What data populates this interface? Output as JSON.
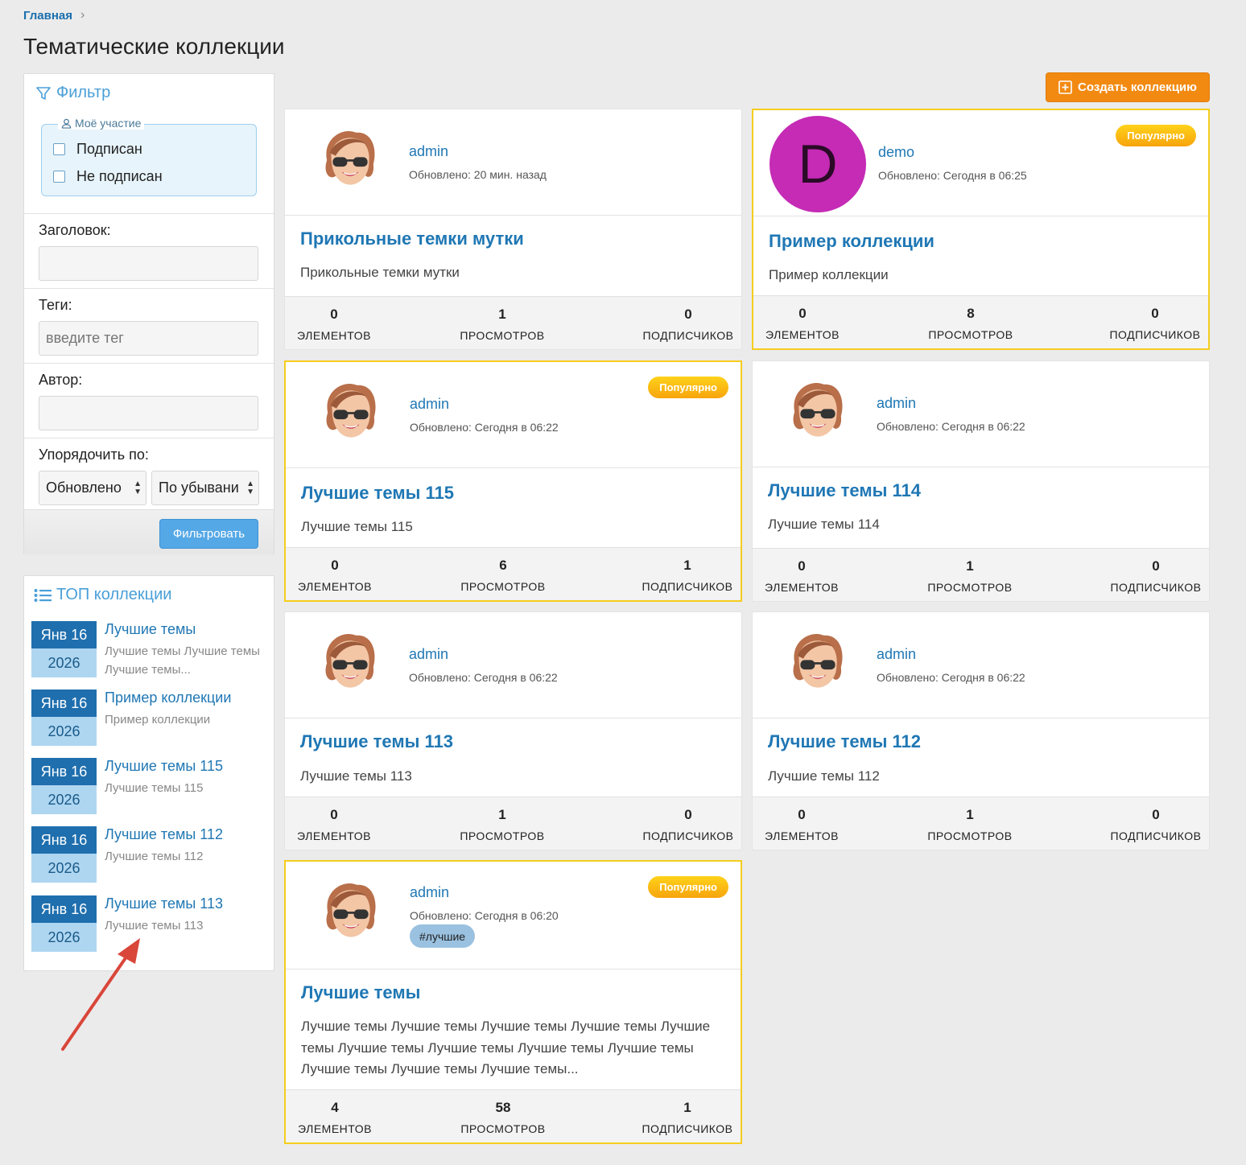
{
  "breadcrumb": {
    "home": "Главная",
    "separator": "›"
  },
  "page_title": "Тематические коллекции",
  "filter": {
    "title": "Фильтр",
    "participation_legend": "Моё участие",
    "subscribed_label": "Подписан",
    "not_subscribed_label": "Не подписан",
    "heading_label": "Заголовок:",
    "tags_label": "Теги:",
    "tags_placeholder": "введите тег",
    "author_label": "Автор:",
    "order_label": "Упорядочить по:",
    "order_field": "Обновлено",
    "order_direction": "По убывани",
    "submit_label": "Фильтровать"
  },
  "top_collections": {
    "title": "ТОП коллекции",
    "items": [
      {
        "date_top": "Янв 16",
        "date_bottom": "2026",
        "title": "Лучшие темы",
        "desc": "Лучшие темы Лучшие темы Лучшие темы..."
      },
      {
        "date_top": "Янв 16",
        "date_bottom": "2026",
        "title": "Пример коллекции",
        "desc": "Пример коллекции"
      },
      {
        "date_top": "Янв 16",
        "date_bottom": "2026",
        "title": "Лучшие темы 115",
        "desc": "Лучшие темы 115"
      },
      {
        "date_top": "Янв 16",
        "date_bottom": "2026",
        "title": "Лучшие темы 112",
        "desc": "Лучшие темы 112"
      },
      {
        "date_top": "Янв 16",
        "date_bottom": "2026",
        "title": "Лучшие темы 113",
        "desc": "Лучшие темы 113"
      }
    ]
  },
  "create_button": "Создать коллекцию",
  "popular_badge": "Популярно",
  "stat_labels": {
    "elements": "ЭЛЕМЕНТОВ",
    "views": "ПРОСМОТРОВ",
    "subscribers": "ПОДПИСЧИКОВ"
  },
  "cards": [
    {
      "author": "admin",
      "updated": "Обновлено: 20 мин. назад",
      "title": "Прикольные темки мутки",
      "desc": "Прикольные темки мутки",
      "elements": "0",
      "views": "1",
      "subscribers": "0"
    },
    {
      "author": "demo",
      "avatar_letter": "D",
      "updated": "Обновлено: Сегодня в 06:25",
      "title": "Пример коллекции",
      "desc": "Пример коллекции",
      "elements": "0",
      "views": "8",
      "subscribers": "0"
    },
    {
      "author": "admin",
      "updated": "Обновлено: Сегодня в 06:22",
      "title": "Лучшие темы 115",
      "desc": "Лучшие темы 115",
      "elements": "0",
      "views": "6",
      "subscribers": "1"
    },
    {
      "author": "admin",
      "updated": "Обновлено: Сегодня в 06:22",
      "title": "Лучшие темы 114",
      "desc": "Лучшие темы 114",
      "elements": "0",
      "views": "1",
      "subscribers": "0"
    },
    {
      "author": "admin",
      "updated": "Обновлено: Сегодня в 06:22",
      "title": "Лучшие темы 113",
      "desc": "Лучшие темы 113",
      "elements": "0",
      "views": "1",
      "subscribers": "0"
    },
    {
      "author": "admin",
      "updated": "Обновлено: Сегодня в 06:22",
      "title": "Лучшие темы 112",
      "desc": "Лучшие темы 112",
      "elements": "0",
      "views": "1",
      "subscribers": "0"
    },
    {
      "author": "admin",
      "updated": "Обновлено: Сегодня в 06:20",
      "tag": "#лучшие",
      "title": "Лучшие темы",
      "desc": "Лучшие темы Лучшие темы Лучшие темы Лучшие темы Лучшие темы Лучшие темы Лучшие темы Лучшие темы Лучшие темы Лучшие темы Лучшие темы Лучшие темы...",
      "elements": "4",
      "views": "58",
      "subscribers": "1"
    }
  ],
  "colors": {
    "accent": "#1f77b4",
    "popular_border": "#f5cd1e",
    "create_button": "#f28a12",
    "filter_button": "#55a8e6",
    "annotation_arrow": "#d9463a"
  }
}
